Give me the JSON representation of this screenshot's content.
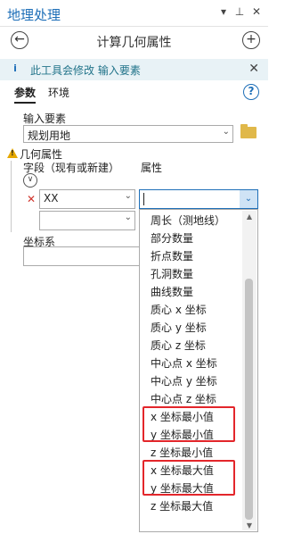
{
  "panel": {
    "title": "地理处理",
    "pin_icon": "pin-icon",
    "menu_icon": "chevron-down-icon",
    "close_icon": "close-icon"
  },
  "nav": {
    "back_icon": "back-arrow-icon",
    "tool_title": "计算几何属性",
    "add_icon": "plus-circle-icon"
  },
  "info": {
    "message": "此工具会修改 输入要素",
    "info_icon": "info-icon"
  },
  "tabs": [
    "参数",
    "环境"
  ],
  "params": {
    "input_features_label": "输入要素",
    "input_features_value": "规划用地",
    "geometry_attributes_label": "几何属性",
    "field_column_label": "字段（现有或新建）",
    "attribute_column_label": "属性",
    "field_row1_value": "XX",
    "field_row2_value": "",
    "coordinate_system_label": "坐标系"
  },
  "dropdown": {
    "current_value": "",
    "options": [
      "周长（测地线）",
      "部分数量",
      "折点数量",
      "孔洞数量",
      "曲线数量",
      "质心 x 坐标",
      "质心 y 坐标",
      "质心 z 坐标",
      "中心点 x 坐标",
      "中心点 y 坐标",
      "中心点 z 坐标",
      "x 坐标最小值",
      "y 坐标最小值",
      "z 坐标最小值",
      "x 坐标最大值",
      "y 坐标最大值",
      "z 坐标最大值"
    ]
  },
  "colors": {
    "accent": "#1e6fb8",
    "highlight": "#e3262b",
    "warning": "#e6a800",
    "info_bg": "#e8f2f6"
  }
}
